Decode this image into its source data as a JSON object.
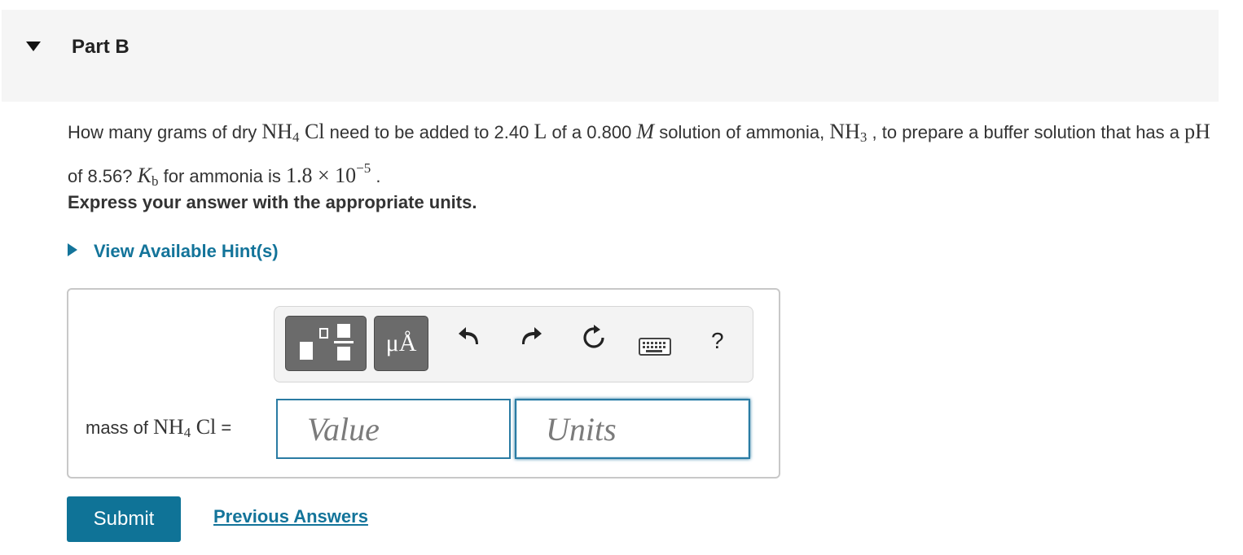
{
  "header": {
    "title": "Part B"
  },
  "question": {
    "t1": "How many grams of dry ",
    "nh4cl_a": "NH",
    "nh4cl_4": "4",
    "nh4cl_b": " Cl",
    "t2": " need to be added to 2.40 ",
    "L": "L",
    "t3": " of a 0.800 ",
    "M": "M",
    "t4": " solution of ammonia, ",
    "nh3_a": "NH",
    "nh3_3": "3",
    "t5": " , to prepare a buffer solution that has a ",
    "pH": "pH",
    "t6": " of 8.56? ",
    "Kb_K": "K",
    "Kb_b": "b",
    "t7": " for ammonia is ",
    "kb_value": "1.8 × 10",
    "kb_exp": "−5",
    "t8": " ."
  },
  "instruction": "Express your answer with the appropriate units.",
  "hint_label": "View Available Hint(s)",
  "toolbar": {
    "units_button_label": "μÅ",
    "help_label": "?"
  },
  "answer": {
    "label_pre": "mass of ",
    "label_nh": "NH",
    "label_4": "4",
    "label_cl": " Cl",
    "label_eq": " =",
    "value_placeholder": "Value",
    "units_placeholder": "Units"
  },
  "submit_label": "Submit",
  "previous_answers_label": "Previous Answers"
}
